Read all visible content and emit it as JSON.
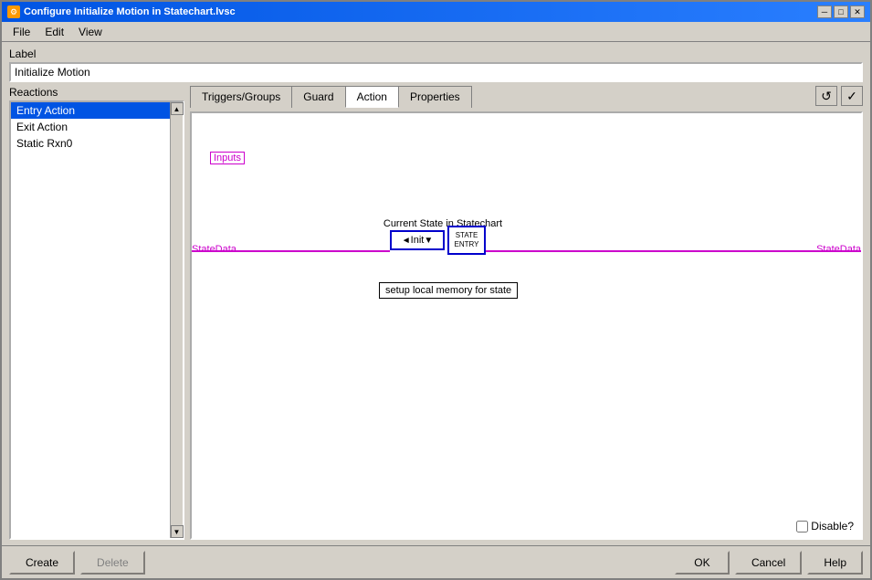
{
  "window": {
    "title": "Configure Initialize Motion in Statechart.lvsc",
    "min_btn": "─",
    "max_btn": "□",
    "close_btn": "✕"
  },
  "menu": {
    "items": [
      "File",
      "Edit",
      "View"
    ]
  },
  "label_section": {
    "label": "Label",
    "value": "Initialize Motion"
  },
  "reactions": {
    "label": "Reactions",
    "items": [
      {
        "id": "entry",
        "text": "Entry Action",
        "selected": true
      },
      {
        "id": "exit",
        "text": "Exit Action",
        "selected": false
      },
      {
        "id": "static",
        "text": "Static Rxn0",
        "selected": false
      }
    ]
  },
  "tabs": [
    {
      "id": "triggers",
      "label": "Triggers/Groups",
      "active": false
    },
    {
      "id": "guard",
      "label": "Guard",
      "active": false
    },
    {
      "id": "action",
      "label": "Action",
      "active": true
    },
    {
      "id": "properties",
      "label": "Properties",
      "active": false
    }
  ],
  "diagram": {
    "inputs_label": "Inputs",
    "node_label": "Current State in Statechart",
    "init_node": "◄Init ▼",
    "state_node_line1": "STATE",
    "state_node_line2": "ENTRY",
    "statedata_left": "StateData",
    "statedata_right": "StateData",
    "setup_label": "setup local memory for state",
    "disable_label": "Disable?"
  },
  "top_buttons": {
    "refresh_icon": "↺",
    "check_icon": "✓"
  },
  "bottom_buttons": {
    "create": "Create",
    "delete": "Delete",
    "ok": "OK",
    "cancel": "Cancel",
    "help": "Help"
  }
}
